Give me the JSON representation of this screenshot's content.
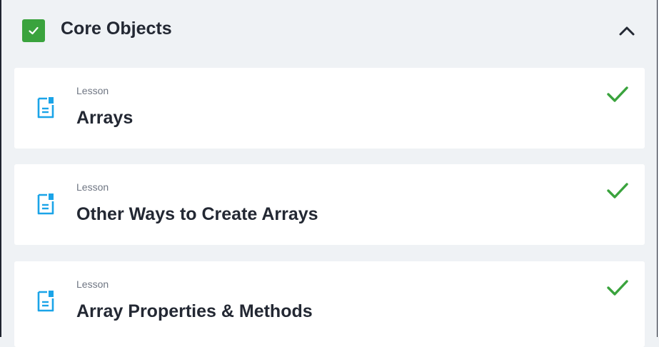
{
  "section": {
    "title": "Core Objects",
    "completed": true,
    "expanded": true
  },
  "lessons": [
    {
      "type": "Lesson",
      "title": "Arrays",
      "completed": true
    },
    {
      "type": "Lesson",
      "title": "Other Ways to Create Arrays",
      "completed": true
    },
    {
      "type": "Lesson",
      "title": "Array Properties & Methods",
      "completed": true
    }
  ],
  "colors": {
    "success_green": "#3aa33d",
    "icon_blue": "#1ba4e8",
    "text_dark": "#232833",
    "text_muted": "#6f7683",
    "panel_bg": "#eff2f5"
  },
  "icons": {
    "section_status": "checkbox-checked-icon",
    "toggle": "chevron-up-icon",
    "lesson": "document-icon",
    "lesson_status": "checkmark-icon"
  }
}
